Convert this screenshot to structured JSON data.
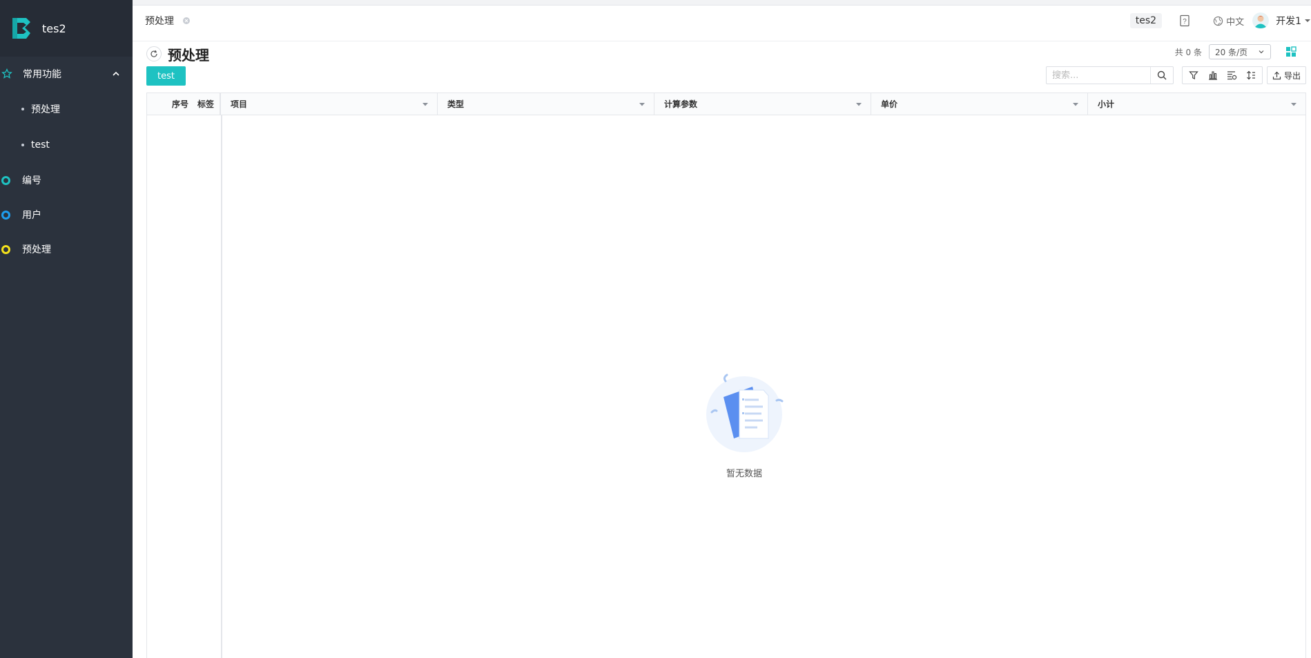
{
  "app": {
    "name": "tes2"
  },
  "sidebar": {
    "section": {
      "label": "常用功能",
      "items": [
        {
          "label": "预处理"
        },
        {
          "label": "test"
        }
      ]
    },
    "items": [
      {
        "label": "编号",
        "color": "#1ec2c2"
      },
      {
        "label": "用户",
        "color": "#1e9ef0"
      },
      {
        "label": "预处理",
        "color": "#f5e21b"
      }
    ],
    "colors": {
      "background": "#2b323d",
      "logo": "#1ec2c2"
    }
  },
  "tabs": [
    {
      "label": "预处理"
    }
  ],
  "header": {
    "project": "tes2",
    "language": "中文",
    "user": "开发1"
  },
  "page": {
    "title": "预处理",
    "total": "共 0 条",
    "page_size": "20 条/页",
    "primary_button": "test",
    "search_placeholder": "搜索...",
    "export_label": "导出"
  },
  "table": {
    "fixed_columns": [
      "序号",
      "标签"
    ],
    "columns": [
      "项目",
      "类型",
      "计算参数",
      "单价",
      "小计"
    ],
    "rows": [],
    "empty_text": "暂无数据"
  },
  "colors": {
    "accent": "#1ec2c2"
  },
  "icons": {
    "logo": "app-logo-icon",
    "section": "star-icon",
    "refresh": "refresh-icon",
    "help": "help-icon",
    "language": "globe-icon",
    "search": "search-icon",
    "filter": "filter-icon",
    "chart": "bar-chart-icon",
    "columns": "column-settings-icon",
    "sort": "sort-icon",
    "export": "export-icon",
    "view": "grid-view-icon"
  }
}
